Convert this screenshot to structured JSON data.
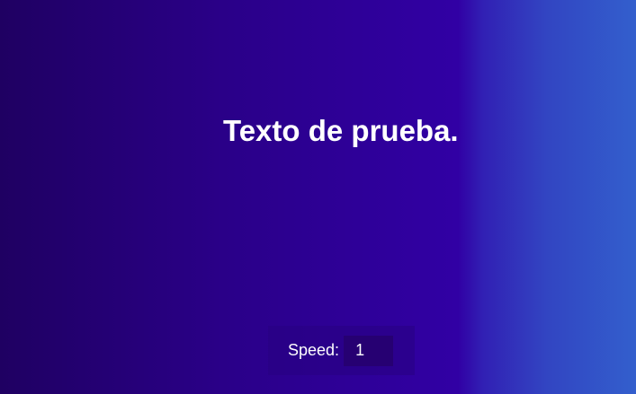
{
  "main": {
    "headline": "Texto de prueba."
  },
  "controls": {
    "speed_label": "Speed:",
    "speed_value": "1"
  },
  "colors": {
    "background_left": "#1f0062",
    "background_mid": "#3100a4",
    "background_right": "#335fcd",
    "text": "#ffffff",
    "input_bg": "#260072"
  }
}
